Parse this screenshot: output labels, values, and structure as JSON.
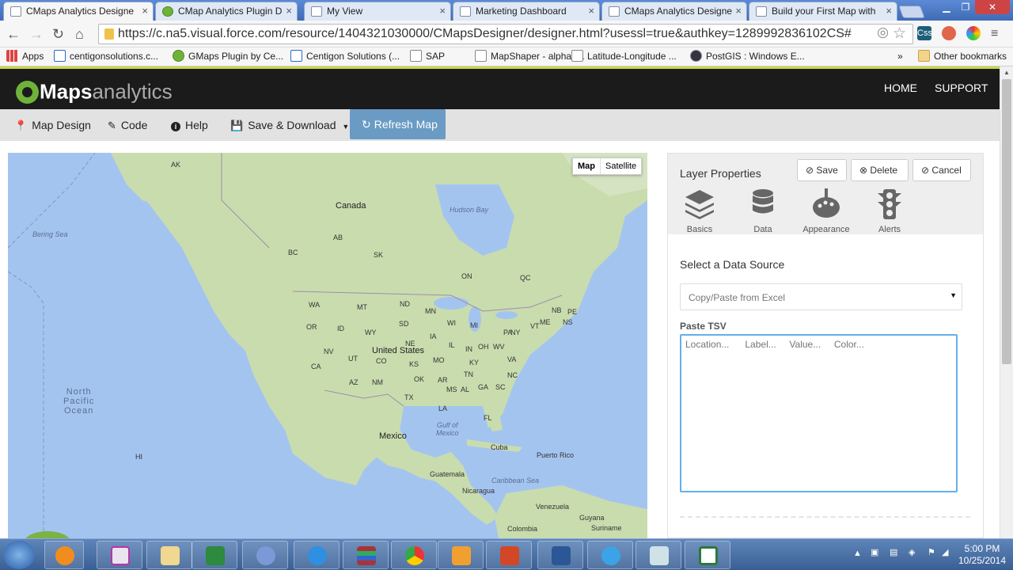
{
  "browser": {
    "tabs": [
      {
        "label": "CMaps Analytics Designe",
        "active": true
      },
      {
        "label": "CMap Analytics Plugin D",
        "active": false
      },
      {
        "label": "My View",
        "active": false
      },
      {
        "label": "Marketing Dashboard",
        "active": false
      },
      {
        "label": "CMaps Analytics Designe",
        "active": false
      },
      {
        "label": "Build your First Map with",
        "active": false
      }
    ],
    "url": "https://c.na5.visual.force.com/resource/1404321030000/CMapsDesigner/designer.html?usessl=true&authkey=1289992836102CS#",
    "bookmarks": [
      "Apps",
      "centigonsolutions.c...",
      "GMaps Plugin by Ce...",
      "Centigon Solutions (...",
      "SAP",
      "MapShaper - alpha t...",
      "Latitude-Longitude ...",
      "PostGIS : Windows E..."
    ],
    "bookmarks_more": "»",
    "other_bookmarks": "Other bookmarks",
    "ext_css_label": "Css"
  },
  "app": {
    "logo_maps": "Maps",
    "logo_analytics": "analytics",
    "nav": {
      "home": "HOME",
      "support": "SUPPORT"
    },
    "toolbar": {
      "map_design": "Map Design",
      "code": "Code",
      "help": "Help",
      "save_download": "Save & Download",
      "refresh_map": "Refresh Map"
    }
  },
  "map": {
    "type_buttons": {
      "map": "Map",
      "satellite": "Satellite"
    },
    "labels": {
      "canada": "Canada",
      "united_states": "United States",
      "mexico": "Mexico",
      "cuba": "Cuba",
      "puerto_rico": "Puerto Rico",
      "guatemala": "Guatemala",
      "nicaragua": "Nicaragua",
      "venezuela": "Venezuela",
      "colombia": "Colombia",
      "guyana": "Guyana",
      "suriname": "Suriname",
      "hudson_bay": "Hudson Bay",
      "bering_sea": "Bering Sea",
      "gulf_of_mexico": "Gulf of\nMexico",
      "caribbean_sea": "Caribbean Sea",
      "north_pacific_ocean": "North\nPacific\nOcean",
      "ak": "AK",
      "bc": "BC",
      "ab": "AB",
      "sk": "SK",
      "on": "ON",
      "qc": "QC",
      "wa": "WA",
      "mt": "MT",
      "nd": "ND",
      "mn": "MN",
      "or": "OR",
      "id": "ID",
      "sd": "SD",
      "wi": "WI",
      "mi": "MI",
      "wy": "WY",
      "ia": "IA",
      "ne": "NE",
      "nv": "NV",
      "ut": "UT",
      "co": "CO",
      "ca": "CA",
      "ks": "KS",
      "mo": "MO",
      "il": "IL",
      "in": "IN",
      "oh": "OH",
      "pa": "PA",
      "ny": "NY",
      "nb": "NB",
      "ns": "NS",
      "pe": "PE",
      "me": "ME",
      "vt": "VT",
      "wv": "WV",
      "va": "VA",
      "ky": "KY",
      "nc": "NC",
      "tn": "TN",
      "az": "AZ",
      "nm": "NM",
      "ok": "OK",
      "ar": "AR",
      "sc": "SC",
      "ms": "MS",
      "al": "AL",
      "ga": "GA",
      "tx": "TX",
      "la": "LA",
      "fl": "FL",
      "hi": "HI"
    }
  },
  "panel": {
    "title": "Layer Properties",
    "buttons": {
      "save": "Save",
      "delete": "Delete",
      "cancel": "Cancel"
    },
    "tabs": {
      "basics": "Basics",
      "data": "Data",
      "appearance": "Appearance",
      "alerts": "Alerts"
    },
    "data_source_title": "Select a Data Source",
    "data_source_value": "Copy/Paste from Excel",
    "tsv_label": "Paste TSV",
    "tsv_placeholder": "Location...      Label...     Value...     Color..."
  },
  "taskbar": {
    "time": "5:00 PM",
    "date": "10/25/2014"
  },
  "colors": {
    "accent": "#6fb23a",
    "header_bg": "#1b1b1b",
    "refresh_btn": "#6a9bc4",
    "map_water": "#a4c4f0",
    "map_land": "#c9dcae"
  }
}
